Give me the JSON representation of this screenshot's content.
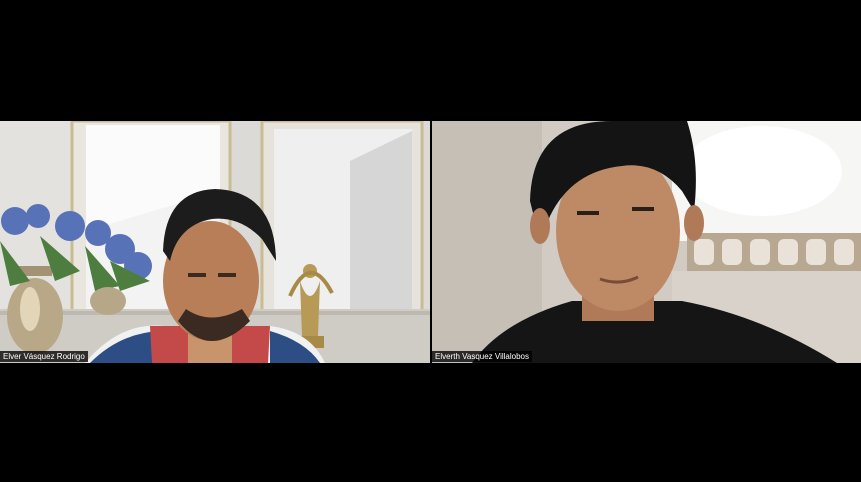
{
  "meeting": {
    "participants": [
      {
        "name": "Elver Vásquez Rodrigo"
      },
      {
        "name": "Elverth Vasquez Villalobos"
      }
    ]
  }
}
